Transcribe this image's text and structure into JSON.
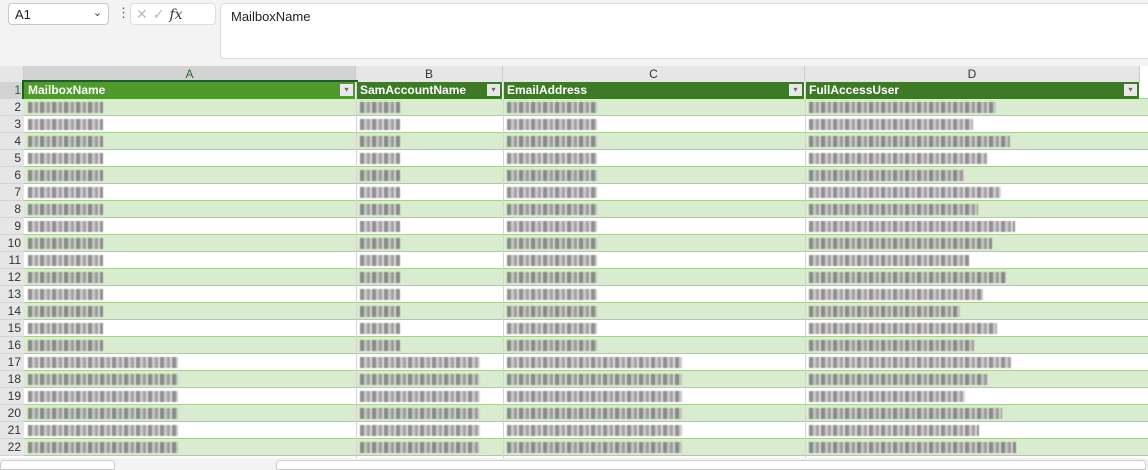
{
  "name_box": {
    "value": "A1"
  },
  "formula_bar": {
    "fx_label": "fx",
    "cancel": "✕",
    "enter": "✓",
    "value": "MailboxName"
  },
  "columns": [
    "A",
    "B",
    "C",
    "D"
  ],
  "headers": [
    "MailboxName",
    "SamAccountName",
    "EmailAddress",
    "FullAccessUser"
  ],
  "row_numbers": [
    "1",
    "2",
    "3",
    "4",
    "5",
    "6",
    "7",
    "8",
    "9",
    "10",
    "11",
    "12",
    "13",
    "14",
    "15",
    "16",
    "17",
    "18",
    "19",
    "20",
    "21",
    "22"
  ],
  "theme": {
    "header_bg": "#3d7a26",
    "band_bg": "#d9ecd0",
    "selection": "#1f6b37"
  }
}
